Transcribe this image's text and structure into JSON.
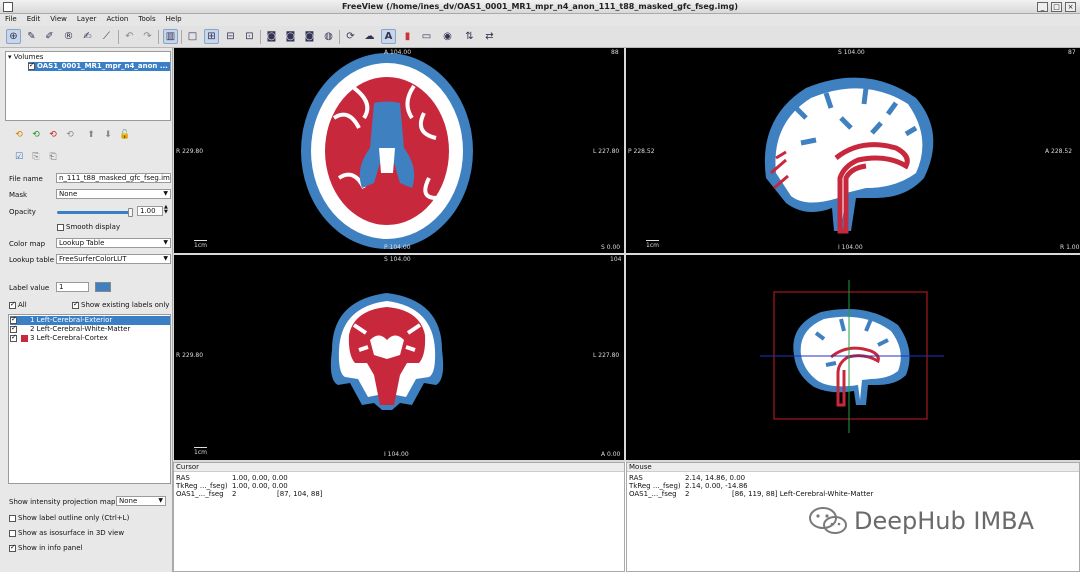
{
  "window": {
    "title": "FreeView (/home/ines_dv/OAS1_0001_MR1_mpr_n4_anon_111_t88_masked_gfc_fseg.img)",
    "min": "_",
    "max": "□",
    "close": "×"
  },
  "menu": [
    "File",
    "Edit",
    "View",
    "Layer",
    "Action",
    "Tools",
    "Help"
  ],
  "layers": {
    "group": "Volumes",
    "item": "OAS1_0001_MR1_mpr_n4_anon ..."
  },
  "props": {
    "file_name_label": "File name",
    "file_name": "n_111_t88_masked_gfc_fseg.img",
    "mask_label": "Mask",
    "mask": "None",
    "opacity_label": "Opacity",
    "opacity": "1.00",
    "opacity_fraction": 1.0,
    "smooth_display": "Smooth display",
    "color_map_label": "Color map",
    "color_map": "Lookup Table",
    "lookup_table_label": "Lookup table",
    "lookup_table": "FreeSurferColorLUT",
    "label_value_label": "Label value",
    "label_value": "1",
    "label_value_color": "#3f80c0",
    "all": "All",
    "show_existing": "Show existing labels only"
  },
  "labels": [
    {
      "text": "1 Left-Cerebral-Exterior",
      "color": "#3f80c0",
      "selected": true
    },
    {
      "text": "2 Left-Cerebral-White-Matter",
      "color": "#ffffff",
      "selected": false
    },
    {
      "text": "3 Left-Cerebral-Cortex",
      "color": "#c8283c",
      "selected": false
    }
  ],
  "bottom_options": {
    "intensity_proj_label": "Show intensity projection map",
    "intensity_proj": "None",
    "outline": "Show label outline only (Ctrl+L)",
    "isosurface": "Show as isosurface in 3D view",
    "info_panel": "Show in info panel"
  },
  "views": {
    "axial": {
      "top": "A 104.00",
      "bottom": "P 104.00",
      "left": "R 229.80",
      "right": "L 227.80",
      "slice": "88",
      "scale": "1cm",
      "coord": "S 0.00"
    },
    "sagittal": {
      "top": "S 104.00",
      "bottom": "I 104.00",
      "left": "P 228.52",
      "right": "A 228.52",
      "slice": "87",
      "scale": "1cm",
      "coord": "R 1.00"
    },
    "coronal": {
      "top": "S 104.00",
      "bottom": "I 104.00",
      "left": "R 229.80",
      "right": "L 227.80",
      "slice": "104",
      "scale": "1cm",
      "coord": "A 0.00"
    }
  },
  "colors": {
    "exterior": "#3f80c0",
    "white_matter": "#ffffff",
    "cortex": "#c8283c",
    "bbox": "#c81e1e"
  },
  "cursor": {
    "title": "Cursor",
    "rows": [
      {
        "name": "RAS",
        "value": "1.00, 0.00, 0.00",
        "extra": ""
      },
      {
        "name": "TkReg ..._fseg)",
        "value": "1.00, 0.00, 0.00",
        "extra": ""
      },
      {
        "name": "OAS1_..._fseg",
        "value": "2",
        "extra": "[87, 104, 88]"
      }
    ]
  },
  "mouse": {
    "title": "Mouse",
    "rows": [
      {
        "name": "RAS",
        "value": "2.14, 14.86, 0.00",
        "extra": ""
      },
      {
        "name": "TkReg ..._fseg)",
        "value": "2.14, 0.00, -14.86",
        "extra": ""
      },
      {
        "name": "OAS1_..._fseg",
        "value": "2",
        "extra": "[86, 119, 88]  Left-Cerebral-White-Matter"
      }
    ]
  },
  "watermark": "DeepHub IMBA"
}
